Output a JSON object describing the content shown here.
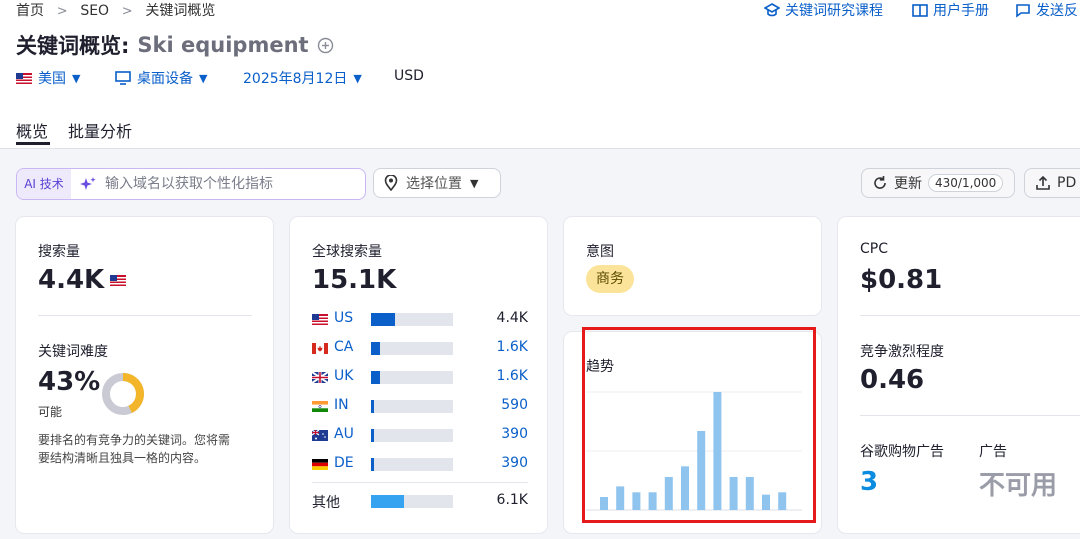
{
  "breadcrumb": [
    "首页",
    "SEO",
    "关键词概览"
  ],
  "top_links": [
    {
      "label": "关键词研究课程",
      "icon": "graduation-cap-icon"
    },
    {
      "label": "用户手册",
      "icon": "book-icon"
    },
    {
      "label": "发送反",
      "icon": "feedback-icon"
    }
  ],
  "title": {
    "prefix": "关键词概览:",
    "keyword": "Ski equipment"
  },
  "filters": {
    "country": "美国",
    "device": "桌面设备",
    "date": "2025年8月12日",
    "currency": "USD"
  },
  "tabs": [
    "概览",
    "批量分析"
  ],
  "ai": {
    "tag": "AI 技术",
    "placeholder": "输入域名以获取个性化指标"
  },
  "location_select": "选择位置",
  "update": {
    "label": "更新",
    "quota": "430/1,000"
  },
  "export": {
    "label": "PD"
  },
  "colors": {
    "accent": "#0a5fc9",
    "bar_light": "#8fc4ef",
    "highlight_red": "#e61a1a",
    "badge": "#fbe49a"
  },
  "search_volume": {
    "label": "搜索量",
    "value": "4.4K"
  },
  "difficulty": {
    "label": "关键词难度",
    "value": "43%",
    "percent": 43,
    "level": "可能",
    "desc_line1": "要排名的有竞争力的关键词。您将需",
    "desc_line2": "要结构清晰且独具一格的内容。"
  },
  "global_volume": {
    "label": "全球搜索量",
    "value": "15.1K",
    "countries": [
      {
        "code": "US",
        "value": "4.4K",
        "fraction": 0.29
      },
      {
        "code": "CA",
        "value": "1.6K",
        "fraction": 0.11
      },
      {
        "code": "UK",
        "value": "1.6K",
        "fraction": 0.11
      },
      {
        "code": "IN",
        "value": "590",
        "fraction": 0.04
      },
      {
        "code": "AU",
        "value": "390",
        "fraction": 0.03
      },
      {
        "code": "DE",
        "value": "390",
        "fraction": 0.03
      }
    ],
    "other": {
      "label": "其他",
      "value": "6.1K",
      "fraction": 0.4
    }
  },
  "intent": {
    "label": "意图",
    "value": "商务"
  },
  "trend": {
    "label": "趋势"
  },
  "chart_data": {
    "type": "bar",
    "title": "趋势",
    "values": [
      0.11,
      0.2,
      0.15,
      0.15,
      0.28,
      0.37,
      0.67,
      1.0,
      0.28,
      0.28,
      0.13,
      0.15
    ],
    "ylim": [
      0,
      1
    ]
  },
  "cpc": {
    "label": "CPC",
    "value": "$0.81"
  },
  "competition": {
    "label": "竞争激烈程度",
    "value": "0.46"
  },
  "shopping": {
    "label": "谷歌购物广告",
    "value": "3"
  },
  "ads": {
    "label": "广告",
    "value": "不可用"
  }
}
